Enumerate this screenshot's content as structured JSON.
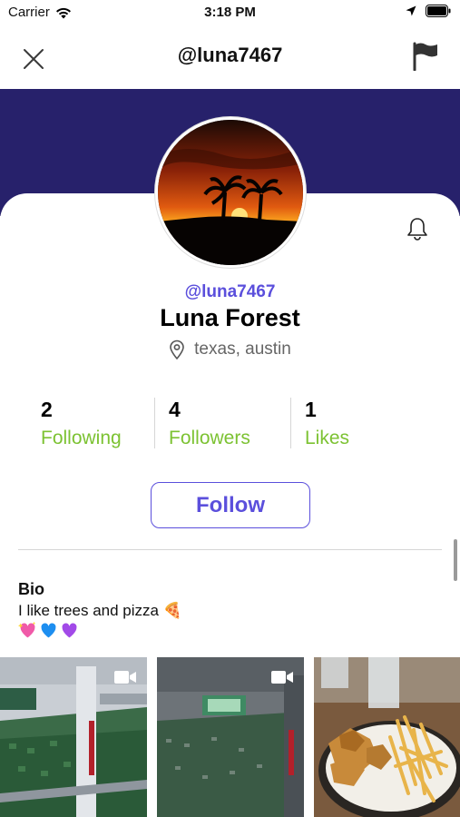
{
  "status_bar": {
    "carrier": "Carrier",
    "time": "3:18 PM"
  },
  "nav": {
    "title": "@luna7467"
  },
  "profile": {
    "handle": "@luna7467",
    "name": "Luna Forest",
    "location": "texas, austin"
  },
  "stats": [
    {
      "count": "2",
      "label": "Following"
    },
    {
      "count": "4",
      "label": "Followers"
    },
    {
      "count": "1",
      "label": "Likes"
    }
  ],
  "follow_label": "Follow",
  "bio": {
    "title": "Bio",
    "text": "I like trees and pizza 🍕"
  },
  "media": [
    {
      "kind": "video",
      "subject": "stadium crowd"
    },
    {
      "kind": "video",
      "subject": "stadium crowd"
    },
    {
      "kind": "photo",
      "subject": "chicken tenders and fries"
    }
  ],
  "colors": {
    "banner": "#27216b",
    "accent": "#5b4fdc",
    "stat_label": "#7cc232",
    "divider": "#d6d6d6"
  },
  "icons": [
    "wifi-icon",
    "location-arrow-icon",
    "battery-icon",
    "close-icon",
    "flag-icon",
    "bell-icon",
    "location-pin-icon",
    "video-camera-icon"
  ]
}
